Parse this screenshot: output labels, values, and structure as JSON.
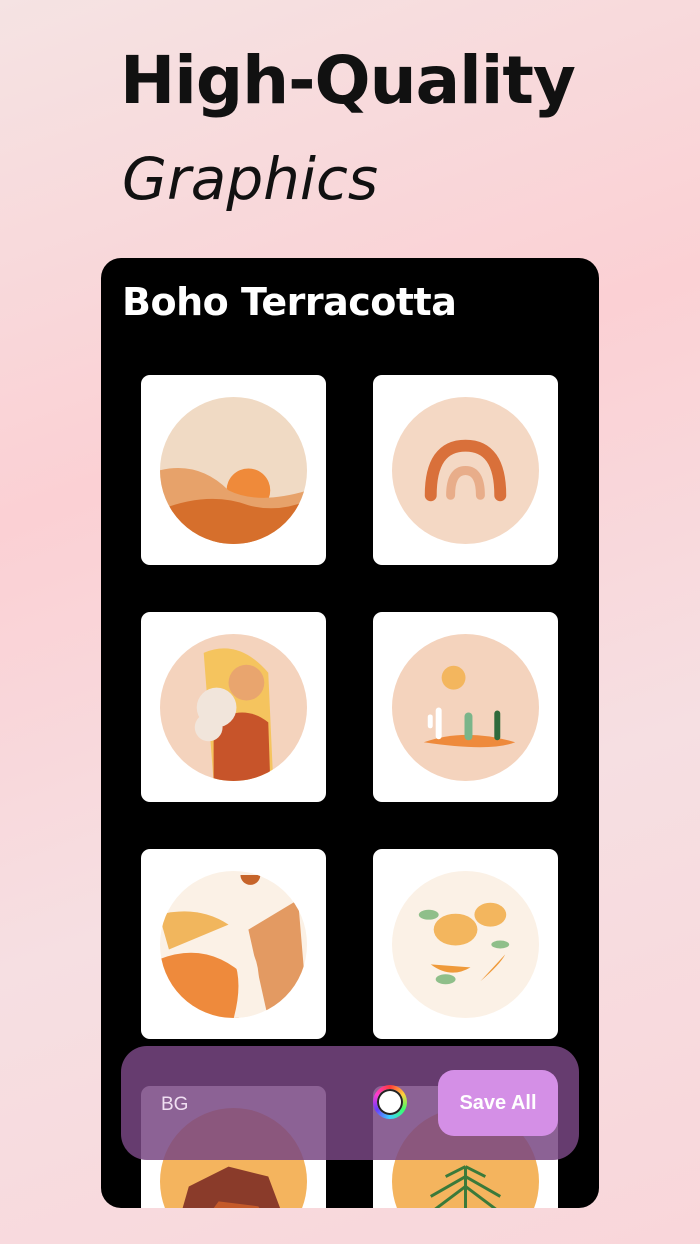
{
  "hero": {
    "title": "High-Quality",
    "subtitle": "Graphics"
  },
  "pack": {
    "title": "Boho Terracotta",
    "icons": [
      {
        "name": "sunset-mountains-icon"
      },
      {
        "name": "rainbow-icon"
      },
      {
        "name": "woman-with-flowers-icon"
      },
      {
        "name": "desert-cactus-icon"
      },
      {
        "name": "river-valley-icon"
      },
      {
        "name": "lemons-icon"
      },
      {
        "name": "rock-formation-icon"
      },
      {
        "name": "palm-leaf-icon"
      }
    ]
  },
  "toolbar": {
    "bg_label": "BG",
    "save_label": "Save All"
  },
  "colors": {
    "accent": "#d48fe6",
    "toolbar": "#78467f",
    "terracotta": "#e07a32"
  }
}
